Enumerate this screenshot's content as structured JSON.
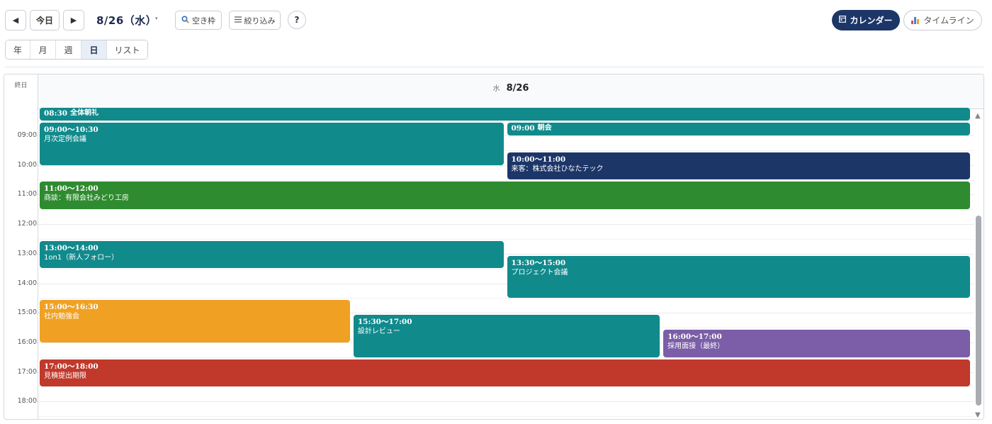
{
  "toolbar": {
    "prev_icon": "◀",
    "today_label": "今日",
    "next_icon": "▶",
    "date_label": "8/26（水）",
    "date_caret": "▾",
    "free_slots_label": "空き枠",
    "filter_label": "絞り込み",
    "help_label": "?",
    "calendar_label": "カレンダー",
    "timeline_label": "タイムライン"
  },
  "icons": {
    "prev": "chevron-left-icon",
    "next": "chevron-right-icon",
    "free_slots": "search-icon",
    "filter": "list-icon",
    "calendar": "calendar-icon",
    "timeline": "bar-chart-icon"
  },
  "view_tabs": [
    {
      "label": "年",
      "active": false
    },
    {
      "label": "月",
      "active": false
    },
    {
      "label": "週",
      "active": false
    },
    {
      "label": "日",
      "active": true
    },
    {
      "label": "リスト",
      "active": false
    }
  ],
  "calendar": {
    "allday_label": "終日",
    "day_of_week": "水",
    "day_date": "8/26",
    "hours": [
      "09:00",
      "10:00",
      "11:00",
      "12:00",
      "13:00",
      "14:00",
      "15:00",
      "16:00",
      "17:00",
      "18:00"
    ]
  },
  "events": [
    {
      "time": "08:30",
      "name": "全体朝礼",
      "color": "#118a8c"
    },
    {
      "time": "09:00〜10:30",
      "name": "月次定例会議",
      "color": "#118a8c"
    },
    {
      "time": "09:00",
      "name": "朝会",
      "color": "#118a8c"
    },
    {
      "time": "10:00〜11:00",
      "name": "来客：株式会社ひなたテック",
      "color": "#1c3668"
    },
    {
      "time": "11:00〜12:00",
      "name": "商談：有限会社みどり工房",
      "color": "#2f8b2f"
    },
    {
      "time": "13:00〜14:00",
      "name": "1on1（新人フォロー）",
      "color": "#118a8c"
    },
    {
      "time": "13:30〜15:00",
      "name": "プロジェクト会議",
      "color": "#118a8c"
    },
    {
      "time": "15:00〜16:30",
      "name": "社内勉強会",
      "color": "#f0a124"
    },
    {
      "time": "15:30〜17:00",
      "name": "設計レビュー",
      "color": "#118a8c"
    },
    {
      "time": "16:00〜17:00",
      "name": "採用面接（最終）",
      "color": "#7b5ea7"
    },
    {
      "time": "17:00〜18:00",
      "name": "見積提出期限",
      "color": "#c0392b"
    }
  ],
  "colors": {
    "primary": "#1c3668",
    "teal": "#118a8c",
    "green": "#2f8b2f",
    "orange": "#f0a124",
    "purple": "#7b5ea7",
    "red": "#c0392b"
  }
}
